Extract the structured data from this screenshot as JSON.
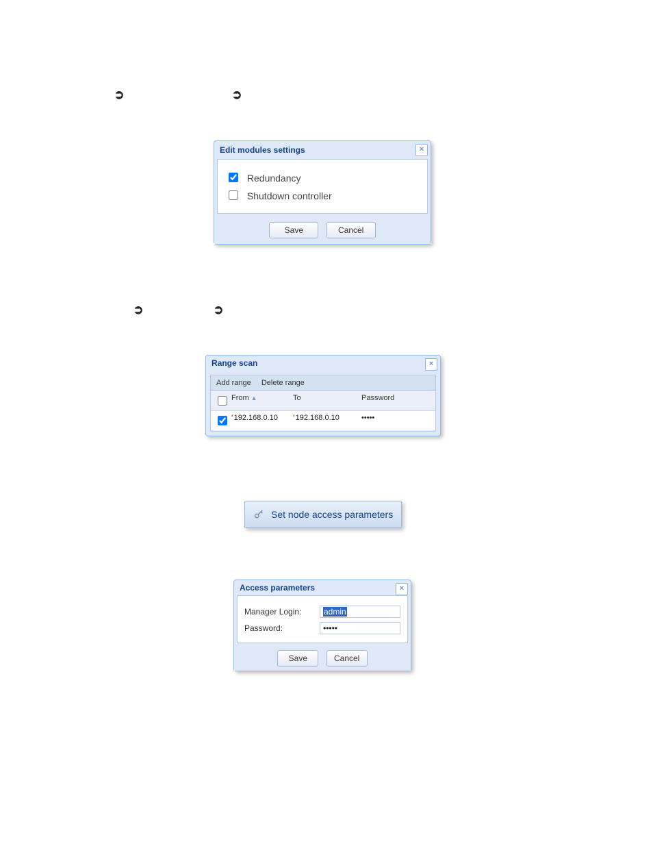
{
  "breadcrumb_arrows": [
    "➲",
    "➲",
    "➲",
    "➲"
  ],
  "edit_modules": {
    "title": "Edit modules settings",
    "close": "×",
    "options": [
      {
        "label": "Redundancy",
        "checked": true
      },
      {
        "label": "Shutdown controller",
        "checked": false
      }
    ],
    "save": "Save",
    "cancel": "Cancel"
  },
  "range_scan": {
    "title": "Range scan",
    "close": "×",
    "toolbar": {
      "add": "Add range",
      "delete": "Delete range"
    },
    "columns": {
      "from": "From",
      "to": "To",
      "password": "Password",
      "sort_indicator": "▲"
    },
    "rows": [
      {
        "checked": true,
        "from": "192.168.0.10",
        "to": "192.168.0.10",
        "password": "•••••"
      }
    ]
  },
  "set_node_button": {
    "label": "Set node access parameters"
  },
  "access_params": {
    "title": "Access parameters",
    "close": "×",
    "login_label": "Manager Login:",
    "login_value": "admin",
    "password_label": "Password:",
    "password_value": "•••••",
    "save": "Save",
    "cancel": "Cancel"
  }
}
